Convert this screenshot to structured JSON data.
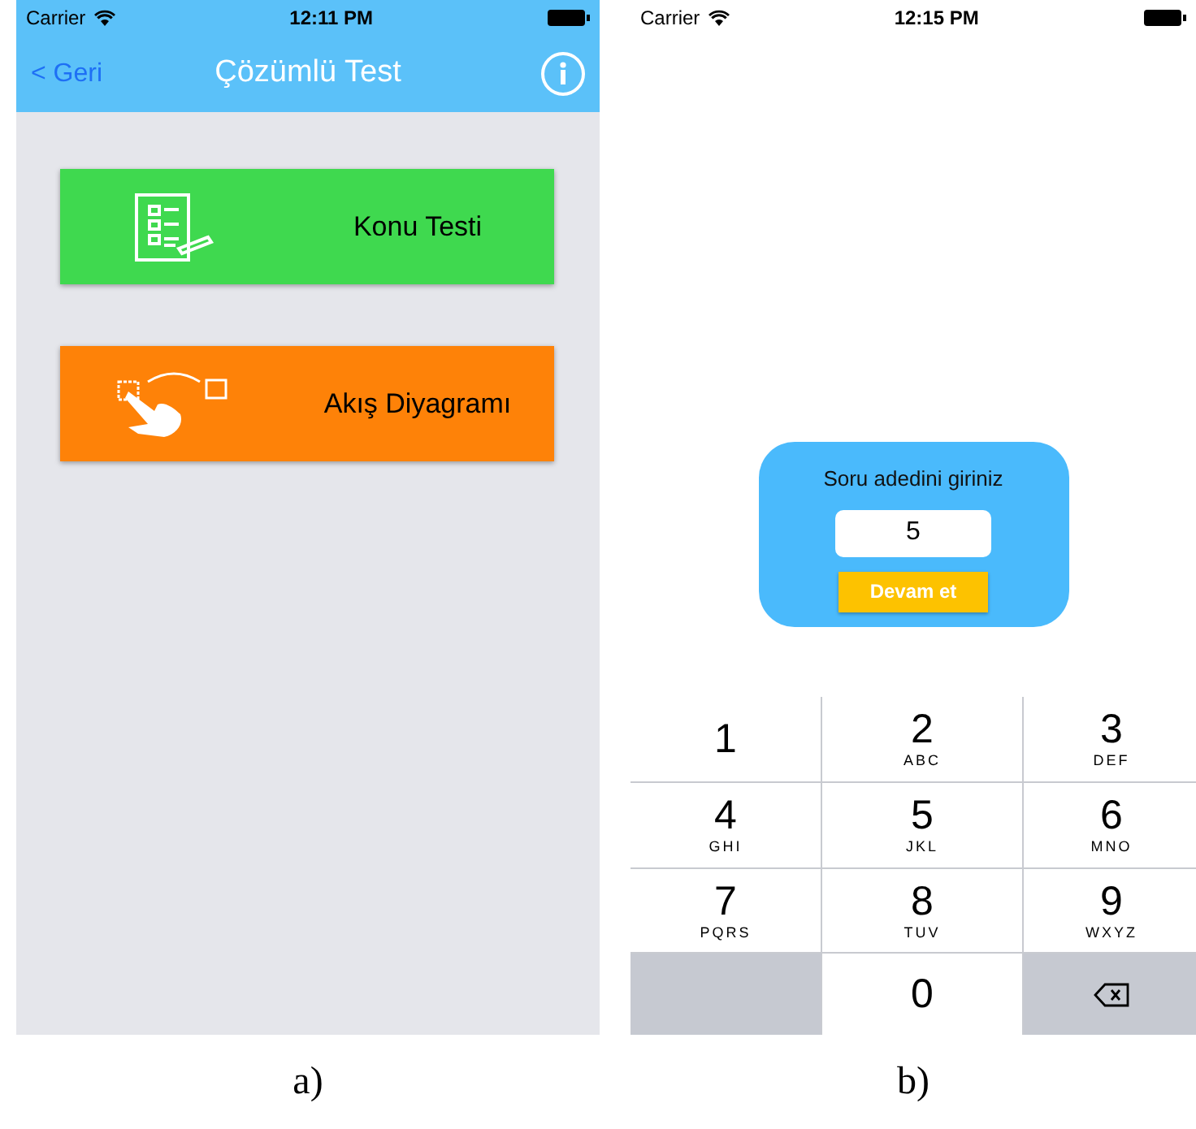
{
  "screen_a": {
    "status_bar": {
      "carrier": "Carrier",
      "time": "12:11 PM"
    },
    "nav_bar": {
      "back": "< Geri",
      "title": "Çözümlü Test"
    },
    "buttons": [
      {
        "label": "Konu Testi",
        "kind": "checklist",
        "color": "#3fd94f"
      },
      {
        "label": "Akış Diyagramı",
        "kind": "tap",
        "color": "#fe8208"
      }
    ],
    "caption": "a)"
  },
  "screen_b": {
    "status_bar": {
      "carrier": "Carrier",
      "time": "12:15 PM"
    },
    "dialog": {
      "prompt": "Soru adedini giriniz",
      "value": "5",
      "button": "Devam et"
    },
    "keypad": [
      {
        "kind": "digit",
        "digit": "1"
      },
      {
        "kind": "digit",
        "digit": "2",
        "letters": "ABC"
      },
      {
        "kind": "digit",
        "digit": "3",
        "letters": "DEF"
      },
      {
        "kind": "digit",
        "digit": "4",
        "letters": "GHI"
      },
      {
        "kind": "digit",
        "digit": "5",
        "letters": "JKL"
      },
      {
        "kind": "digit",
        "digit": "6",
        "letters": "MNO"
      },
      {
        "kind": "digit",
        "digit": "7",
        "letters": "PQRS"
      },
      {
        "kind": "digit",
        "digit": "8",
        "letters": "TUV"
      },
      {
        "kind": "digit",
        "digit": "9",
        "letters": "WXYZ"
      },
      {
        "kind": "blank"
      },
      {
        "kind": "digit",
        "digit": "0"
      },
      {
        "kind": "delete"
      }
    ],
    "caption": "b)"
  }
}
